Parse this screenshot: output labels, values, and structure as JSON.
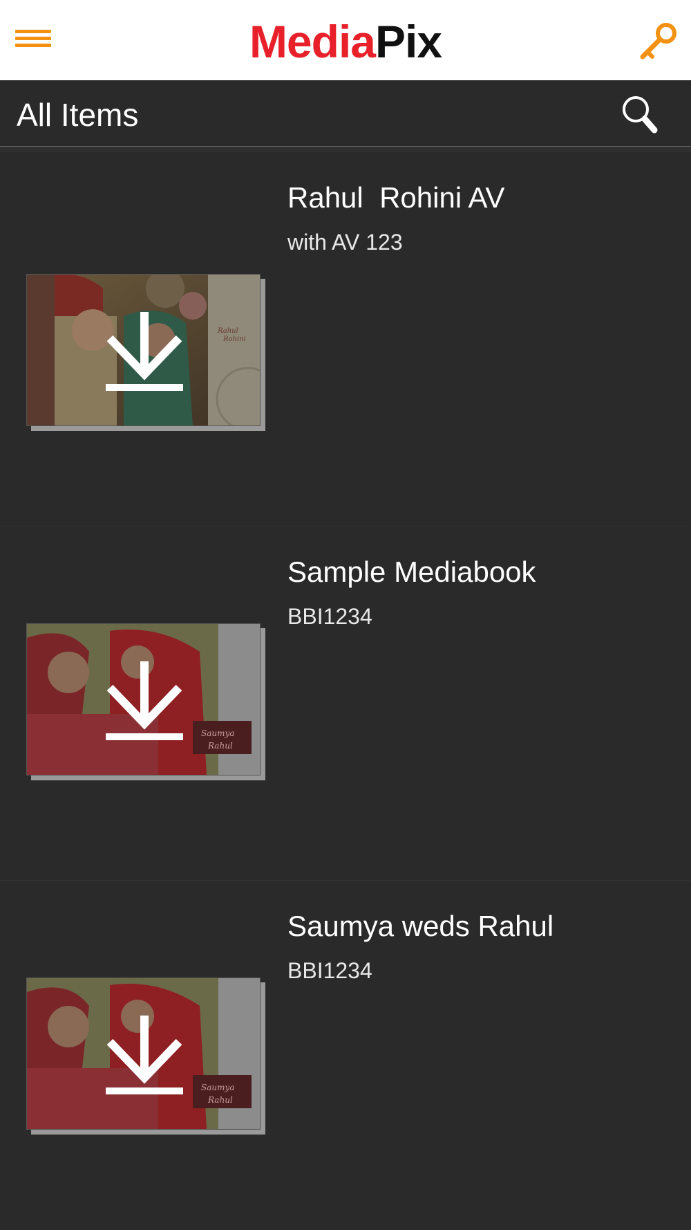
{
  "header": {
    "logo_part1": "Media",
    "logo_part2": "Pix",
    "menu_icon": "hamburger-menu-icon",
    "key_icon": "key-icon",
    "accent_color": "#f39212",
    "logo_red": "#e8202a"
  },
  "subheader": {
    "title": "All Items",
    "search_icon": "search-icon"
  },
  "items": [
    {
      "title": "Rahul  Rohini AV",
      "subtitle": "with AV 123",
      "action_icon": "download-icon"
    },
    {
      "title": "Sample Mediabook",
      "subtitle": "BBI1234",
      "action_icon": "download-icon"
    },
    {
      "title": "Saumya weds Rahul",
      "subtitle": "BBI1234",
      "action_icon": "download-icon"
    }
  ]
}
